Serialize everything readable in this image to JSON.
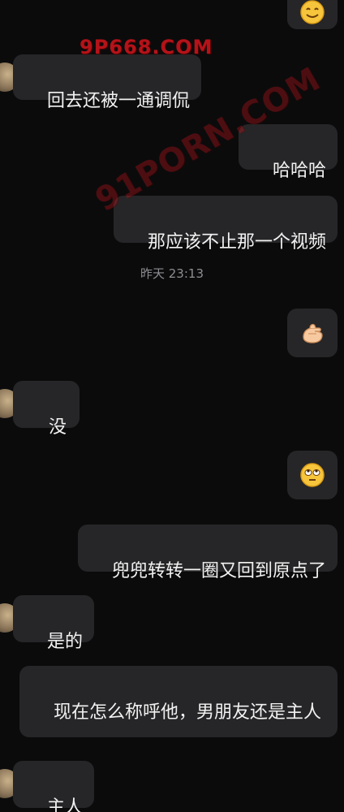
{
  "watermarks": {
    "top": "9P668.COM",
    "diagonal": "91PORN.COM"
  },
  "timestamp": "昨天 23:13",
  "messages": [
    {
      "side": "right",
      "type": "emoji",
      "icon": "smiling-face-icon"
    },
    {
      "side": "left",
      "type": "text",
      "text": "回去还被一通调侃"
    },
    {
      "side": "right",
      "type": "text",
      "text": "哈哈哈"
    },
    {
      "side": "right",
      "type": "text",
      "text": "那应该不止那一个视频"
    },
    {
      "side": "right",
      "type": "emoji",
      "icon": "pinching-hand-icon"
    },
    {
      "side": "left",
      "type": "text",
      "text": "没"
    },
    {
      "side": "right",
      "type": "emoji",
      "icon": "rolling-eyes-face-icon"
    },
    {
      "side": "right",
      "type": "text",
      "text": "兜兜转转一圈又回到原点了"
    },
    {
      "side": "left",
      "type": "text",
      "text": "是的"
    },
    {
      "side": "left",
      "type": "text",
      "text": "现在怎么称呼他，男朋友还是主人"
    },
    {
      "side": "left",
      "type": "text",
      "text": "主人"
    }
  ],
  "colors": {
    "background": "#0b0b0c",
    "bubble": "#262628",
    "text": "#f2f2f2",
    "timestamp": "#8e8e93",
    "watermark": "#c7141b"
  }
}
